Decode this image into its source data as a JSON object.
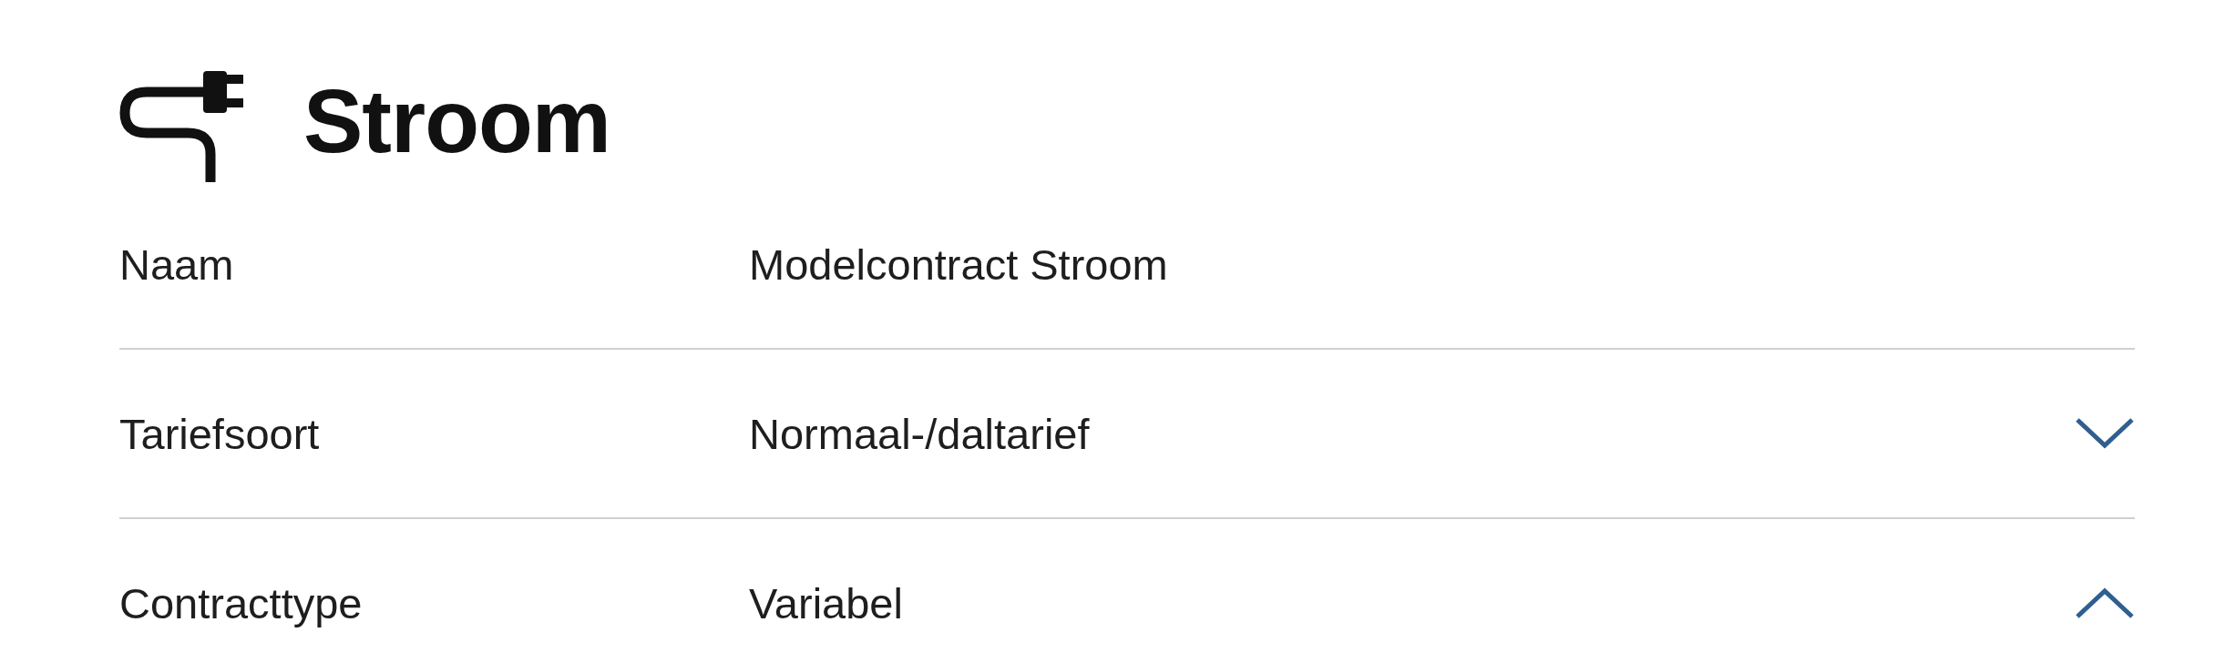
{
  "heading": {
    "title": "Stroom"
  },
  "rows": [
    {
      "label": "Naam",
      "value": "Modelcontract Stroom"
    },
    {
      "label": "Tariefsoort",
      "value": "Normaal-/daltarief",
      "expanded": false
    },
    {
      "label": "Contracttype",
      "value": "Variabel",
      "expanded": true
    }
  ]
}
